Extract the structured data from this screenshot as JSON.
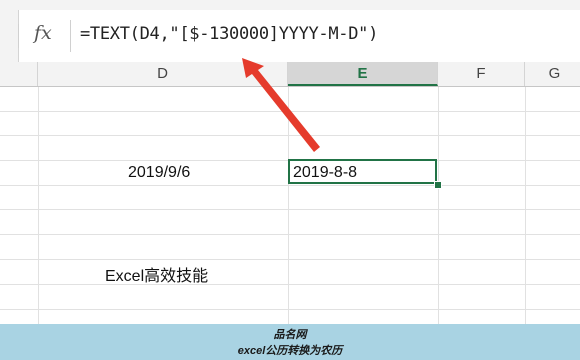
{
  "formula_bar": {
    "fx_label": "fx",
    "formula": "=TEXT(D4,\"[$-130000]YYYY-M-D\")"
  },
  "columns": [
    "D",
    "E",
    "F",
    "G"
  ],
  "active_column": "E",
  "cells": {
    "d4": "2019/9/6",
    "e4": "2019-8-8",
    "d8": "Excel高效技能"
  },
  "watermark": {
    "line1": "品名网",
    "line2": "excel公历转换为农历"
  },
  "colors": {
    "accent": "#217346",
    "arrow": "#e53b2c",
    "band": "#a9d3e3"
  },
  "icons": [
    "arrow-annotation"
  ]
}
